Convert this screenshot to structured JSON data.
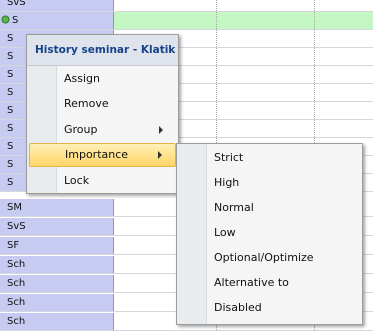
{
  "rows": [
    {
      "label": "SvS",
      "selected": false
    },
    {
      "label": "S",
      "selected": true
    },
    {
      "label": "S",
      "selected": false
    },
    {
      "label": "S",
      "selected": false
    },
    {
      "label": "S",
      "selected": false
    },
    {
      "label": "S",
      "selected": false
    },
    {
      "label": "S",
      "selected": false
    },
    {
      "label": "S",
      "selected": false
    },
    {
      "label": "S",
      "selected": false
    },
    {
      "label": "S",
      "selected": false
    },
    {
      "label": "S",
      "selected": false
    },
    {
      "label": "SM",
      "selected": false
    },
    {
      "label": "SvS",
      "selected": false
    },
    {
      "label": "SF",
      "selected": false
    },
    {
      "label": "Sch",
      "selected": false
    },
    {
      "label": "Sch",
      "selected": false
    },
    {
      "label": "Sch",
      "selected": false
    },
    {
      "label": "Sch",
      "selected": false
    }
  ],
  "context_menu": {
    "title": "History seminar - Klatik",
    "items": [
      {
        "label": "Assign",
        "has_submenu": false
      },
      {
        "label": "Remove",
        "has_submenu": false
      },
      {
        "label": "Group",
        "has_submenu": true
      },
      {
        "label": "Importance",
        "has_submenu": true,
        "highlighted": true
      },
      {
        "label": "Lock",
        "has_submenu": false
      }
    ]
  },
  "importance_submenu": {
    "items": [
      {
        "label": "Strict"
      },
      {
        "label": "High"
      },
      {
        "label": "Normal"
      },
      {
        "label": "Low"
      },
      {
        "label": "Optional/Optimize"
      },
      {
        "label": "Alternative to"
      },
      {
        "label": "Disabled"
      }
    ]
  },
  "colors": {
    "row_header": "#c7cbf1",
    "selected_row": "#c4f7c4",
    "menu_highlight": "#ffd666",
    "menu_title_text": "#15428b"
  }
}
